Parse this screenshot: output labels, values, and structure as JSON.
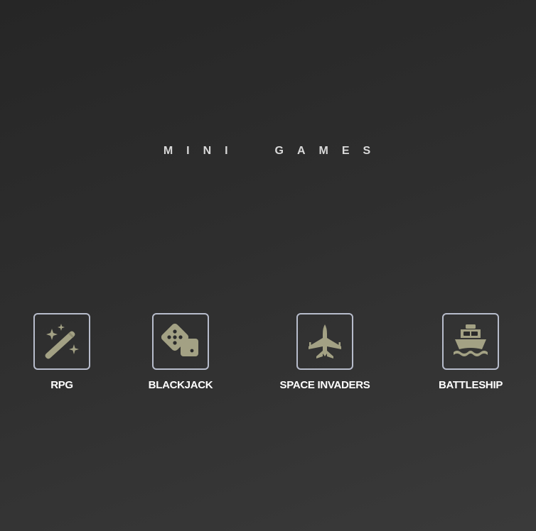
{
  "page": {
    "title": "MINI  GAMES"
  },
  "colors": {
    "icon_fill": "#a3a184",
    "icon_border": "#b7bccb",
    "label": "#ffffff",
    "title": "#d9d9d9"
  },
  "games": [
    {
      "label": "RPG",
      "icon": "magic-wand-icon"
    },
    {
      "label": "BLACKJACK",
      "icon": "dice-icon"
    },
    {
      "label": "SPACE INVADERS",
      "icon": "fighter-jet-icon"
    },
    {
      "label": "BATTLESHIP",
      "icon": "ship-icon"
    }
  ]
}
